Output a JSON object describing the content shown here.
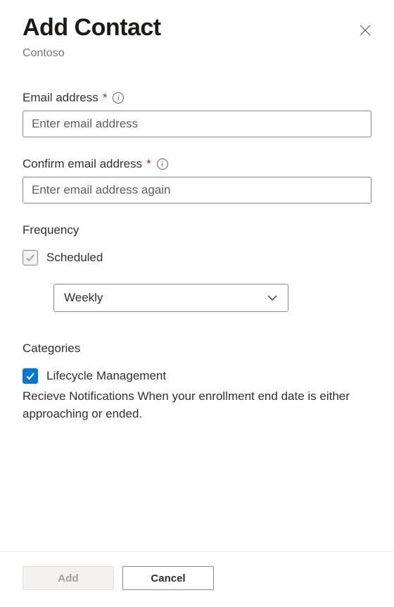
{
  "title": "Add Contact",
  "subtitle": "Contoso",
  "email": {
    "label": "Email address",
    "placeholder": "Enter email address",
    "value": ""
  },
  "confirm_email": {
    "label": "Confirm email address",
    "placeholder": "Enter email address again",
    "value": ""
  },
  "frequency": {
    "label": "Frequency",
    "scheduled_label": "Scheduled",
    "scheduled_checked": true,
    "select_value": "Weekly"
  },
  "categories": {
    "label": "Categories",
    "items": [
      {
        "label": "Lifecycle Management",
        "checked": true,
        "description": "Recieve Notifications When your enrollment end date is either approaching or ended."
      }
    ]
  },
  "footer": {
    "add_label": "Add",
    "cancel_label": "Cancel"
  },
  "colors": {
    "accent": "#0078d4",
    "required": "#a4262c"
  }
}
